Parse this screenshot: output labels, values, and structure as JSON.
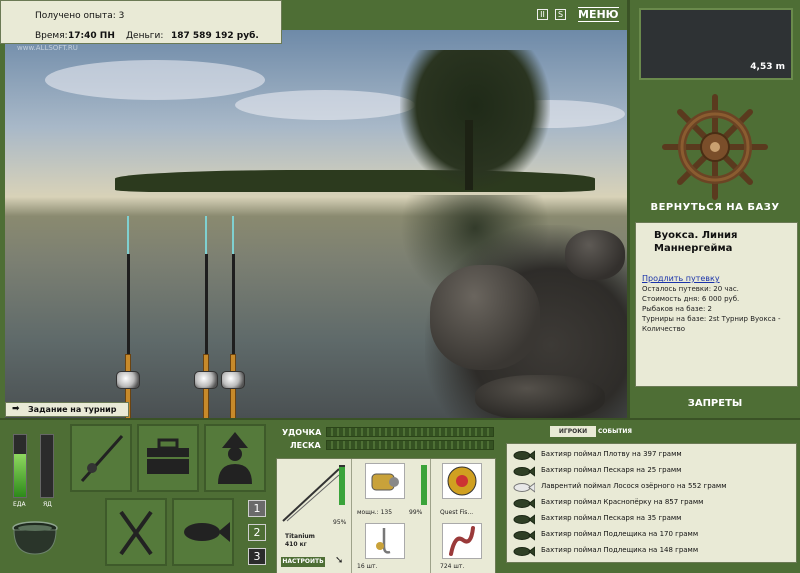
{
  "header": {
    "experience": "Получено опыта: 3",
    "time_label": "Время:",
    "time_value": "17:40 ПН",
    "money_label": "Деньги:",
    "money_value": "187 589 192 руб.",
    "watermark": "www.ALLSOFT.RU",
    "pause_label": "II",
    "sound_label": "S",
    "menu_label": "МЕНЮ"
  },
  "right_panel": {
    "depth": "4,53 m",
    "return_label": "ВЕРНУТЬСЯ НА БАЗУ",
    "location": "Вуокса. Линия Маннергейма",
    "extend_link": "Продлить путевку",
    "lines": [
      "Осталось путевки: 20 час.",
      "Стоимость дня: 6 000 руб.",
      "Рыбаков на базе: 2",
      "Турниры на базе: 2st Турнир Вуокса - Количество"
    ],
    "bans_label": "ЗАПРЕТЫ"
  },
  "task_label": "Задание на турнир",
  "status": {
    "food_label": "ЕДА",
    "poison_label": "ЯД",
    "food_level": 0.7,
    "poison_level": 0.0
  },
  "page_buttons": [
    "1",
    "2",
    "3"
  ],
  "gear": {
    "rod_label": "УДОЧКА",
    "line_label": "ЛЕСКА",
    "rod_condition": "95%",
    "rod_name": "Titanium",
    "rod_weight": "410 кг",
    "setup_label": "НАСТРОИТЬ",
    "reel_power": "мощн.: 135",
    "reel_condition": "99%",
    "line_name": "Quest Fis...",
    "hooks_count": "16 шт.",
    "bait_count": "724 шт.",
    "rod_condition_level": 0.95,
    "reel_condition_level": 0.99
  },
  "log": {
    "tab_players": "ИГРОКИ",
    "tab_events": "СОБЫТИЯ",
    "entries": [
      {
        "text": "Бахтияр поймал Плотву на 397 грамм",
        "fish": "dark"
      },
      {
        "text": "Бахтияр поймал Пескаря на 25 грамм",
        "fish": "dark"
      },
      {
        "text": "Лаврентий поймал Лосося озёрного на 552 грамм",
        "fish": "silver"
      },
      {
        "text": "Бахтияр поймал Краснопёрку на 857 грамм",
        "fish": "dark"
      },
      {
        "text": "Бахтияр поймал Пескаря на 35 грамм",
        "fish": "dark"
      },
      {
        "text": "Бахтияр поймал Подлещика на 170 грамм",
        "fish": "dark"
      },
      {
        "text": "Бахтияр поймал Подлещика на 148 грамм",
        "fish": "dark"
      }
    ]
  },
  "icons": {
    "rod_tile": "fishing-rod-icon",
    "box_tile": "tackle-box-icon",
    "fisherman_tile": "fisherman-icon",
    "cutlery_tile": "cutlery-icon",
    "fish_tile": "fish-icon",
    "pot": "cauldron-icon",
    "helm": "ship-wheel-icon"
  },
  "colors": {
    "panel_green": "#4e6e35",
    "paper": "#e9ead6",
    "food_green": "#3aa33a"
  }
}
